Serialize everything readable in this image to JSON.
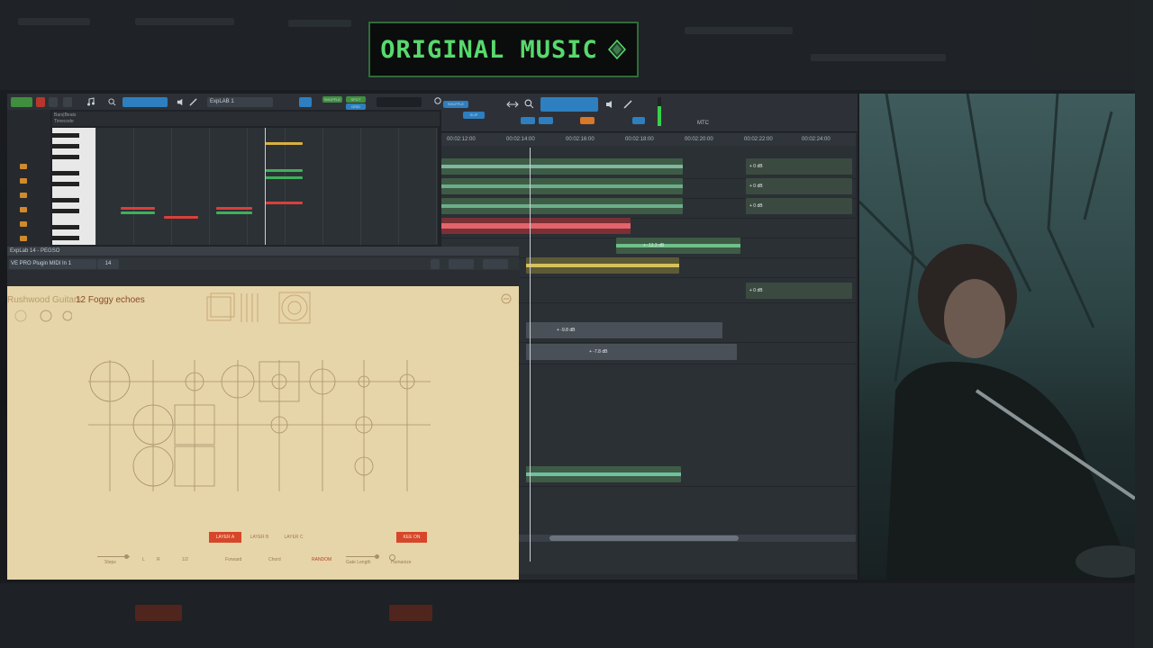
{
  "overlay": {
    "title": "ORIGINAL MUSIC"
  },
  "daw": {
    "toolbar": {
      "shuffle": "SHUFFLE",
      "spot": "SPOT",
      "slip": "SLIP",
      "grid": "GRID",
      "mtc": "MTC",
      "track_name": "ExpLAB 1"
    },
    "piano_roll": {
      "ruler_labels": [
        "Bars|Beats",
        "Timecode"
      ]
    },
    "arrange": {
      "timecodes": [
        "00:02:12:00",
        "00:02:14:00",
        "00:02:16:00",
        "00:02:18:00",
        "00:02:20:00",
        "00:02:22:00",
        "00:02:24:00"
      ],
      "clip_gains": [
        "+ 0 dB",
        "+ 0 dB",
        "+ 0 dB",
        "+ -13.3 dB",
        "+ 0 dB",
        "+ -9.8 dB",
        "+ -7.8 dB"
      ]
    }
  },
  "plugin": {
    "window_title": "ExpLab 14 - PEGSO",
    "insert_name": "VE PRO Plugin MIDI In 1",
    "insert_channel": "14",
    "instrument": "Rushwood Guitars",
    "preset": "12 Foggy echoes",
    "layers": [
      "LAYER A",
      "LAYER B",
      "LAYER C"
    ],
    "keys_button": "KEE ON",
    "controls": {
      "steps": "Steps",
      "l": "L",
      "r": "R",
      "rate": "1/2",
      "direction": "Forward",
      "mode": "Chord",
      "random": "RANDOM",
      "gate_length": "Gate Length",
      "humanize": "Humanize"
    }
  },
  "colors": {
    "badge_text": "#58d96e",
    "badge_border": "#2f6b3c",
    "plugin_bg": "#e6d5a8",
    "accent": "#d6462a",
    "selected_tool": "#2e7fbf"
  }
}
